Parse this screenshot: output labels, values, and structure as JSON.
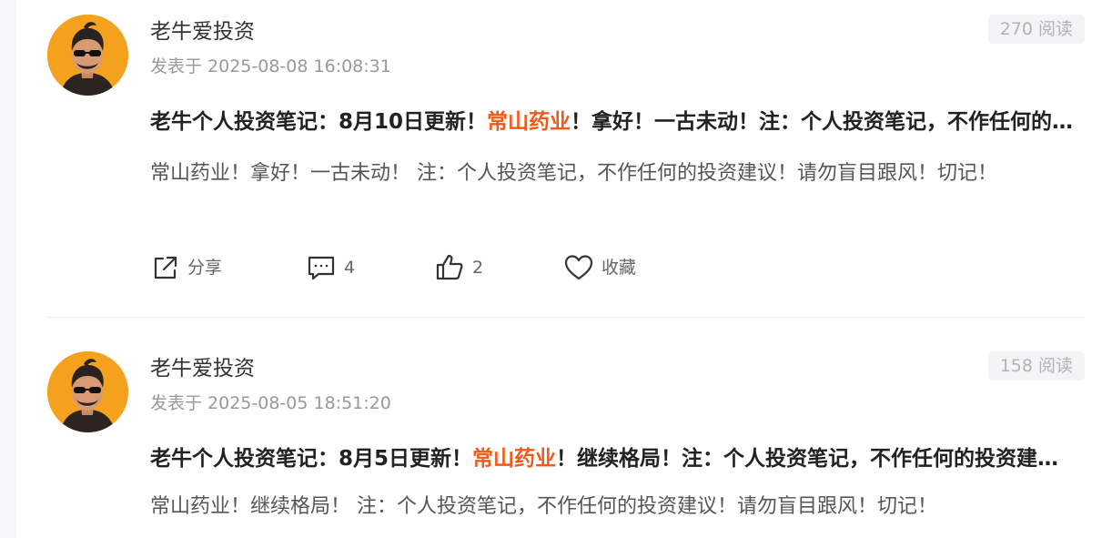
{
  "colors": {
    "highlight": "#f05b1a",
    "avatar_bg": "#f4a21e"
  },
  "posts": [
    {
      "author": "老牛爱投资",
      "published": "发表于 2025-08-08 16:08:31",
      "reads": "270 阅读",
      "title_before": "老牛个人投资笔记：8月10日更新！",
      "title_highlight": "常山药业",
      "title_after": "！拿好！一古未动！注：个人投资笔记，不作任何的投资建议！请勿盲目跟风！切记！",
      "summary": "常山药业！拿好！一古未动！ 注：个人投资笔记，不作任何的投资建议！请勿盲目跟风！切记！",
      "actions": {
        "share": "分享",
        "comments": "4",
        "likes": "2",
        "favorite": "收藏"
      }
    },
    {
      "author": "老牛爱投资",
      "published": "发表于 2025-08-05 18:51:20",
      "reads": "158 阅读",
      "title_before": "老牛个人投资笔记：8月5日更新！",
      "title_highlight": "常山药业",
      "title_after": "！继续格局！注：个人投资笔记，不作任何的投资建议！请勿盲目跟风！切记！",
      "summary": "常山药业！继续格局！ 注：个人投资笔记，不作任何的投资建议！请勿盲目跟风！切记！"
    }
  ]
}
